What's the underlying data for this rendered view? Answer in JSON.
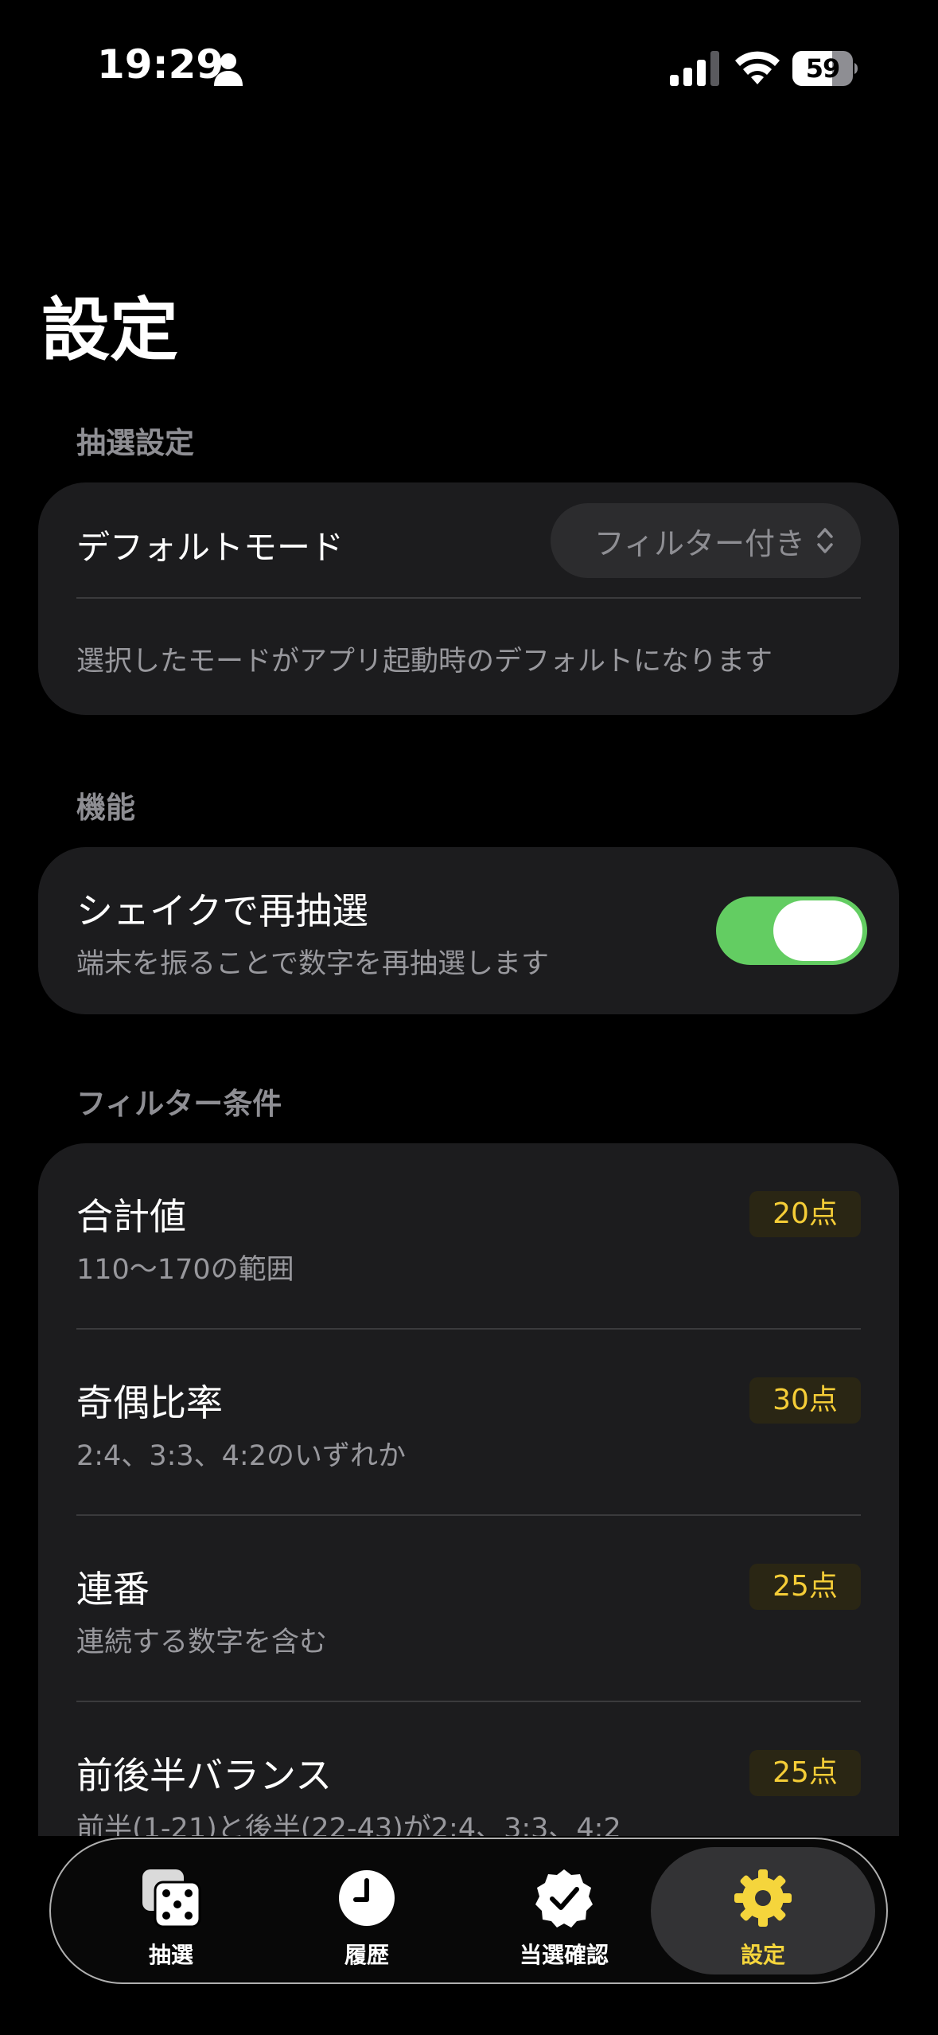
{
  "status_bar": {
    "time": "19:29",
    "battery_level": "59"
  },
  "page_title": "設定",
  "sections": {
    "lottery": {
      "header": "抽選設定",
      "default_mode_label": "デフォルトモード",
      "default_mode_value": "フィルター付き",
      "footer": "選択したモードがアプリ起動時のデフォルトになります"
    },
    "features": {
      "header": "機能",
      "shake_label": "シェイクで再抽選",
      "shake_sub": "端末を振ることで数字を再抽選します",
      "shake_enabled": true
    },
    "filters": {
      "header": "フィルター条件",
      "items": [
        {
          "title": "合計値",
          "sub": "110〜170の範囲",
          "points": "20点"
        },
        {
          "title": "奇偶比率",
          "sub": "2:4、3:3、4:2のいずれか",
          "points": "30点"
        },
        {
          "title": "連番",
          "sub": "連続する数字を含む",
          "points": "25点"
        },
        {
          "title": "前後半バランス",
          "sub": "前半(1-21)と後半(22-43)が2:4、3:3、4:2",
          "points": "25点"
        }
      ]
    }
  },
  "tab_bar": {
    "tabs": [
      {
        "label": "抽選",
        "icon": "dice-icon"
      },
      {
        "label": "履歴",
        "icon": "clock-icon"
      },
      {
        "label": "当選確認",
        "icon": "checkmark-seal-icon"
      },
      {
        "label": "設定",
        "icon": "gear-icon",
        "active": true
      }
    ]
  },
  "colors": {
    "accent": "#f5d53c",
    "toggle_on": "#63cd62",
    "card_bg": "#1c1c1e"
  }
}
